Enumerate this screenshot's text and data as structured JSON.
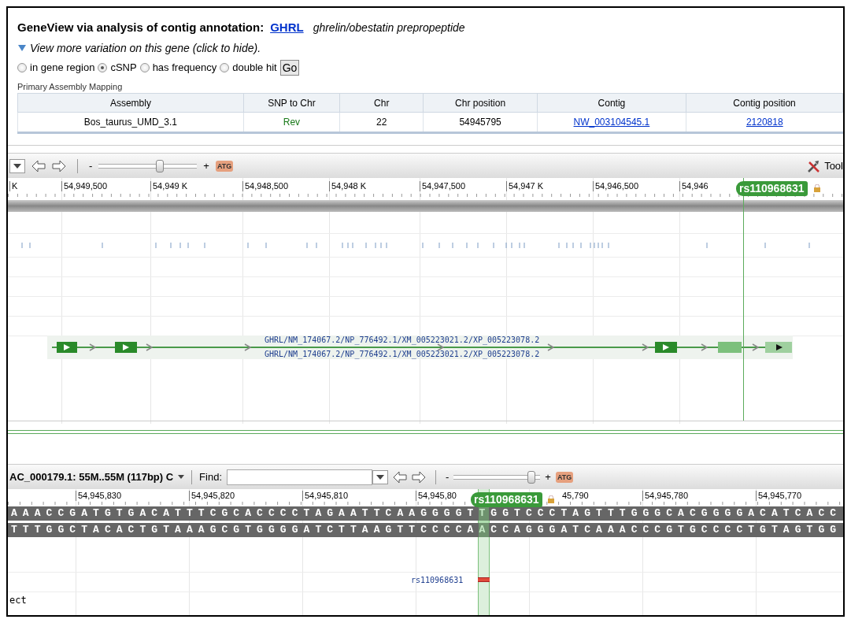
{
  "header": {
    "title": "GeneView via analysis of contig annotation:",
    "gene_link": "GHRL",
    "gene_description": "ghrelin/obestatin prepropeptide"
  },
  "toggle": {
    "label": "View more variation on this gene (click to hide).",
    "expanded": true
  },
  "filters": [
    {
      "label": "in gene region",
      "selected": false
    },
    {
      "label": "cSNP",
      "selected": true
    },
    {
      "label": "has frequency",
      "selected": false
    },
    {
      "label": "double hit",
      "selected": false
    }
  ],
  "go_button": "Go",
  "mapping": {
    "caption": "Primary Assembly Mapping",
    "columns": [
      "Assembly",
      "SNP to Chr",
      "Chr",
      "Chr position",
      "Contig",
      "Contig position"
    ],
    "rows": [
      [
        {
          "kind": "text",
          "text": "Bos_taurus_UMD_3.1"
        },
        {
          "kind": "status",
          "text": "Rev"
        },
        {
          "kind": "text",
          "text": "22"
        },
        {
          "kind": "text",
          "text": "54945795"
        },
        {
          "kind": "link",
          "text": "NW_003104545.1"
        },
        {
          "kind": "link",
          "text": "2120818"
        }
      ]
    ]
  },
  "gene_viewer": {
    "toolbar": {
      "minus": "-",
      "plus": "+",
      "zoom": {
        "level": 0.62
      },
      "atg": "ATG",
      "tools": "Tool"
    },
    "ruler": [
      "K",
      "54,949,500",
      "54,949 K",
      "54,948,500",
      "54,948 K",
      "54,947,500",
      "54,947 K",
      "54,946,500",
      "54,946"
    ],
    "marker": "rs110968631",
    "gene_labels": [
      "GHRL/NM_174067.2/NP_776492.1/XM_005223021.2/XP_005223078.2",
      "GHRL/NM_174067.2/NP_776492.1/XM_005223021.2/XP_005223078.2"
    ]
  },
  "sequence_viewer": {
    "toolbar": {
      "region": "AC_000179.1: 55M..55M (117bp) C",
      "find_label": "Find:",
      "minus": "-",
      "plus": "+",
      "zoom": {
        "level": 0.9
      },
      "atg": "ATG"
    },
    "ruler": [
      "54,945,830",
      "54,945,820",
      "54,945,810",
      "54,945,80",
      "45,790",
      "54,945,780",
      "54,945,770"
    ],
    "marker": "rs110968631",
    "strands": [
      "AAACCGATGTGACATTTCGCACCCCTAGAATTCAAGGGGTTGGTCCCTAGTTTGGGCACGGGGACATCACC",
      "TTTGGCTACACTGTAAAGCGTGGGGATCTTAAGTTCCCCAACCAGGGATCAAACCCGTGCCCCTGTAGTGG"
    ],
    "snp_label": "rs110968631",
    "track_label": "ect"
  }
}
